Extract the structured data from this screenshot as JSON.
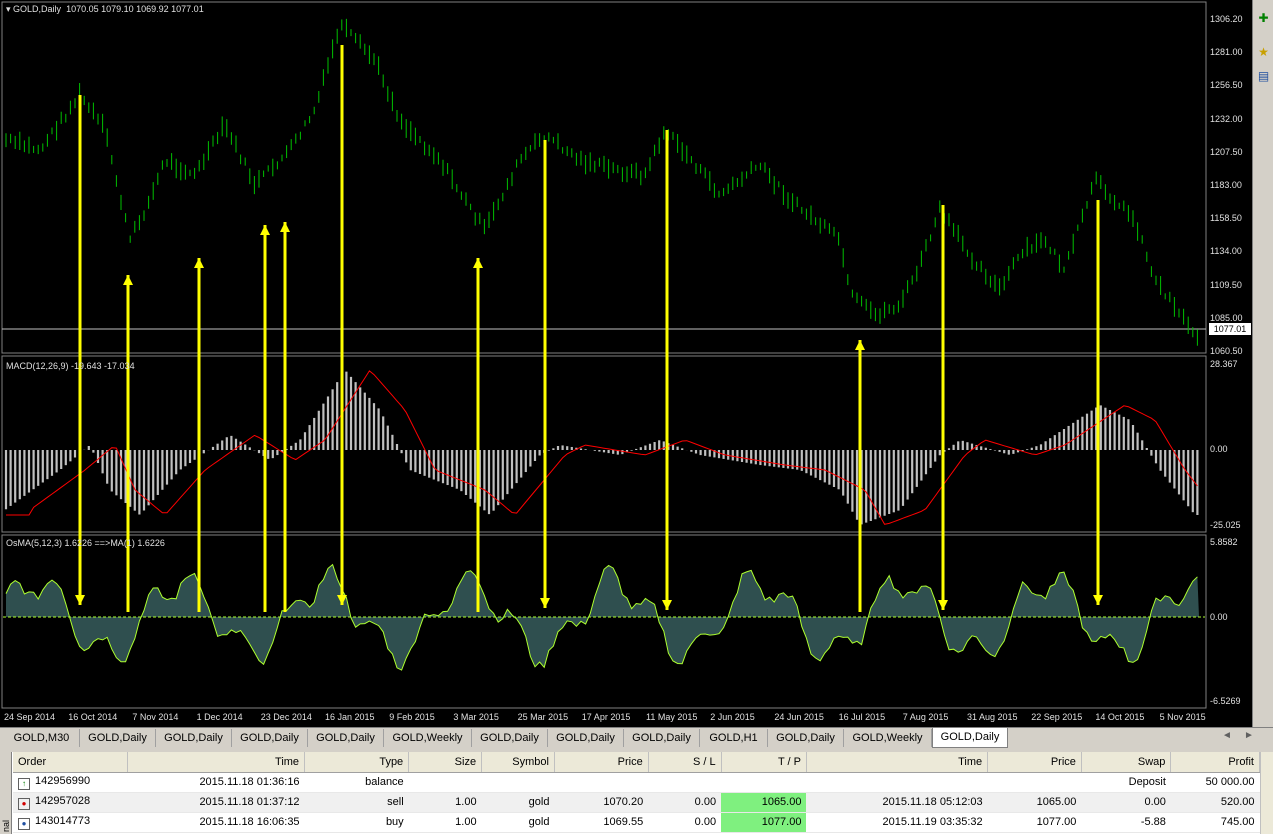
{
  "main_pane": {
    "title": "GOLD,Daily",
    "ohlc": "1070.05 1079.10 1069.92 1077.01",
    "price_ticks": [
      "1306.20",
      "1281.00",
      "1256.50",
      "1232.00",
      "1207.50",
      "1183.00",
      "1158.50",
      "1134.00",
      "1109.50",
      "1085.00",
      "1060.50"
    ],
    "current_price": "1077.01"
  },
  "macd_pane": {
    "label": "MACD(12,26,9) -19.643 -17.034",
    "ticks": [
      "28.367",
      "0.00",
      "-25.025"
    ]
  },
  "osma_pane": {
    "label": "OsMA(5,12,3) 1.6226  ==>MA(1) 1.6226",
    "ticks": [
      "5.8582",
      "0.00",
      "-6.5269"
    ]
  },
  "date_axis": [
    "24 Sep 2014",
    "16 Oct 2014",
    "7 Nov 2014",
    "1 Dec 2014",
    "23 Dec 2014",
    "16 Jan 2015",
    "9 Feb 2015",
    "3 Mar 2015",
    "25 Mar 2015",
    "17 Apr 2015",
    "11 May 2015",
    "2 Jun 2015",
    "24 Jun 2015",
    "16 Jul 2015",
    "7 Aug 2015",
    "31 Aug 2015",
    "22 Sep 2015",
    "14 Oct 2015",
    "5 Nov 2015"
  ],
  "tabs": [
    "GOLD,M30",
    "GOLD,Daily",
    "GOLD,Daily",
    "GOLD,Daily",
    "GOLD,Daily",
    "GOLD,Weekly",
    "GOLD,Daily",
    "GOLD,Daily",
    "GOLD,Daily",
    "GOLD,H1",
    "GOLD,Daily",
    "GOLD,Weekly",
    "GOLD,Daily"
  ],
  "tab_nav": {
    "prev": "◄",
    "next": "►"
  },
  "terminal": {
    "side_label": "nal",
    "columns": [
      "Order",
      "Time",
      "Type",
      "Size",
      "Symbol",
      "Price",
      "S / L",
      "T / P",
      "Time",
      "Price",
      "Swap",
      "Profit"
    ],
    "rows": [
      {
        "order": "142956990",
        "time": "2015.11.18 01:36:16",
        "type": "balance",
        "size": "",
        "symbol": "",
        "price": "",
        "sl": "",
        "tp": "",
        "close_time": "",
        "close_price": "",
        "swap": "Deposit",
        "profit": "50 000.00"
      },
      {
        "order": "142957028",
        "time": "2015.11.18 01:37:12",
        "type": "sell",
        "size": "1.00",
        "symbol": "gold",
        "price": "1070.20",
        "sl": "0.00",
        "tp": "1065.00",
        "close_time": "2015.11.18 05:12:03",
        "close_price": "1065.00",
        "swap": "0.00",
        "profit": "520.00"
      },
      {
        "order": "143014773",
        "time": "2015.11.18 16:06:35",
        "type": "buy",
        "size": "1.00",
        "symbol": "gold",
        "price": "1069.55",
        "sl": "0.00",
        "tp": "1077.00",
        "close_time": "2015.11.19 03:35:32",
        "close_price": "1077.00",
        "swap": "-5.88",
        "profit": "745.00"
      }
    ]
  },
  "colors": {
    "bars": "#00c000",
    "macd_hist": "#c0c0c0",
    "signal": "#ff0000",
    "osma_fill": "#2f4f4f",
    "osma_line": "#adff2f",
    "arrows": "#ffff00",
    "tp_highlight": "#7ff07f"
  }
}
